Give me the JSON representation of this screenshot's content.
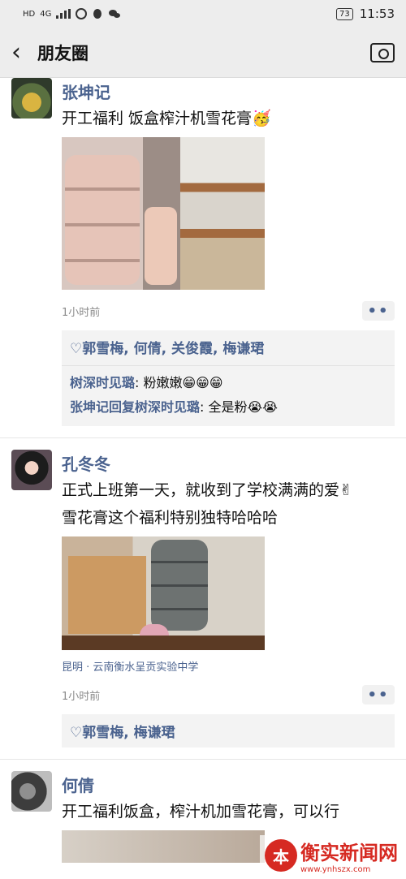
{
  "status": {
    "left_icons": [
      "HD",
      "4G"
    ],
    "battery": "73",
    "time": "11:53"
  },
  "nav": {
    "title": "朋友圈"
  },
  "posts": [
    {
      "name": "张坤记",
      "text": "开工福利 饭盒榨汁机雪花膏🥳",
      "time": "1小时前",
      "likes": "郭雪梅, 何倩, 关俊霞, 梅谦珺",
      "comments": [
        {
          "author": "树深时见璐",
          "text": "粉嫩嫩😁😁😁"
        },
        {
          "author": "张坤记回复树深时见璐",
          "text": "全是粉😭😭"
        }
      ]
    },
    {
      "name": "孔冬冬",
      "text": "正式上班第一天，就收到了学校满满的爱✌",
      "text2": "雪花膏这个福利特别独特哈哈哈",
      "location": "昆明 · 云南衡水呈贡实验中学",
      "time": "1小时前",
      "likes": "郭雪梅, 梅谦珺"
    },
    {
      "name": "何倩",
      "text": "开工福利饭盒，榨汁机加雪花膏，可以行"
    }
  ],
  "watermark": {
    "logo": "本",
    "name": "衡实新闻网",
    "url": "www.ynhszx.com"
  }
}
